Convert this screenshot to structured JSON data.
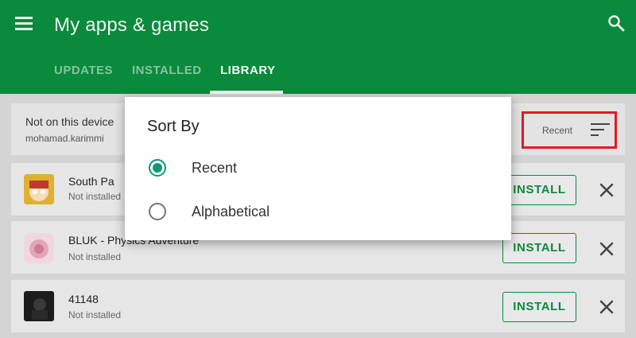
{
  "app_bar": {
    "title": "My apps & games",
    "menu_icon": "hamburger-menu-icon",
    "search_icon": "search-icon",
    "color": "#0a8a3c"
  },
  "tabs": [
    {
      "label": "UPDATES",
      "active": false
    },
    {
      "label": "INSTALLED",
      "active": false
    },
    {
      "label": "LIBRARY",
      "active": true
    }
  ],
  "library": {
    "section_title": "Not on this device",
    "account": "mohamad.karimmi",
    "sort_label": "Recent",
    "sort_icon": "sort-icon"
  },
  "apps": [
    {
      "name": "South Pa",
      "status": "Not installed",
      "install_label": "INSTALL",
      "icon": "south-park-app-icon"
    },
    {
      "name": "BLUK - Physics Adventure",
      "status": "Not installed",
      "install_label": "INSTALL",
      "icon": "bluk-app-icon"
    },
    {
      "name": "41148",
      "status": "Not installed",
      "install_label": "INSTALL",
      "icon": "41148-app-icon"
    }
  ],
  "dialog": {
    "title": "Sort By",
    "options": [
      {
        "label": "Recent",
        "selected": true
      },
      {
        "label": "Alphabetical",
        "selected": false
      }
    ],
    "accent": "#0a9a74"
  },
  "highlight_color": "#e01b24"
}
